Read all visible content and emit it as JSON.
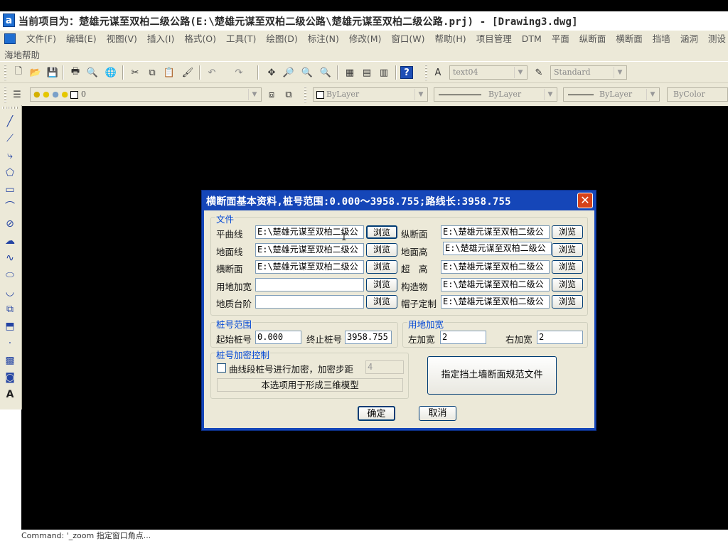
{
  "window": {
    "title": "当前项目为：楚雄元谋至双柏二级公路(E:\\楚雄元谋至双柏二级公路\\楚雄元谋至双柏二级公路.prj) - [Drawing3.dwg]"
  },
  "menubar": {
    "items": [
      "文件(F)",
      "编辑(E)",
      "视图(V)",
      "插入(I)",
      "格式(O)",
      "工具(T)",
      "绘图(D)",
      "标注(N)",
      "修改(M)",
      "窗口(W)",
      "帮助(H)",
      "项目管理",
      "DTM",
      "平面",
      "纵断面",
      "横断面",
      "挡墙",
      "涵洞",
      "测设"
    ],
    "extra_item": "海地帮助"
  },
  "toolbar1": {
    "text_style": "text04",
    "dim_style": "Standard"
  },
  "toolbar2": {
    "layer_value": "0",
    "color": "ByLayer",
    "linetype": "ByLayer",
    "lineweight": "ByLayer",
    "plotstyle": "ByColor"
  },
  "command_line": {
    "text": "Command: '_zoom 指定窗口角点..."
  },
  "dialog": {
    "title": "横断面基本资料,桩号范围:0.000～3958.755;路线长:3958.755",
    "close_glyph": "✕",
    "file_group": {
      "label": "文件",
      "browse_label": "浏览",
      "left": [
        {
          "label": "平曲线",
          "value": "E:\\楚雄元谋至双柏二级公"
        },
        {
          "label": "地面线",
          "value": "E:\\楚雄元谋至双柏二级公"
        },
        {
          "label": "横断面",
          "value": "E:\\楚雄元谋至双柏二级公"
        },
        {
          "label": "用地加宽",
          "value": ""
        },
        {
          "label": "地质台阶",
          "value": ""
        }
      ],
      "right": [
        {
          "label": "纵断面",
          "value": "E:\\楚雄元谋至双柏二级公"
        },
        {
          "label": "地面高",
          "value": "E:\\楚雄元谋至双柏二级公"
        },
        {
          "label": "超　高",
          "value": "E:\\楚雄元谋至双柏二级公"
        },
        {
          "label": "构造物",
          "value": "E:\\楚雄元谋至双柏二级公"
        },
        {
          "label": "帽子定制",
          "value": "E:\\楚雄元谋至双柏二级公"
        }
      ]
    },
    "station_range": {
      "label": "桩号范围",
      "start_label": "起始桩号",
      "start_value": "0.000",
      "end_label": "终止桩号",
      "end_value": "3958.755"
    },
    "land_widen": {
      "label": "用地加宽",
      "left_label": "左加宽",
      "left_value": "2",
      "right_label": "右加宽",
      "right_value": "2"
    },
    "densify": {
      "label": "桩号加密控制",
      "checkbox_label": "曲线段桩号进行加密，加密步距",
      "step_value": "4",
      "note": "本选项用于形成三维模型"
    },
    "retaining_wall_button": "指定挡土墙断面规范文件",
    "ok_label": "确定",
    "cancel_label": "取消"
  }
}
